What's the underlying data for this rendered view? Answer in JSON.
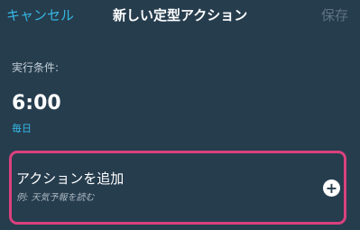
{
  "header": {
    "cancel_label": "キャンセル",
    "title": "新しい定型アクション",
    "save_label": "保存"
  },
  "condition": {
    "label": "実行条件:",
    "time": "6:00",
    "recurrence": "毎日"
  },
  "action": {
    "title": "アクションを追加",
    "hint": "例: 天気予報を読む",
    "icon": "plus-circle-icon"
  },
  "colors": {
    "background": "#263d4e",
    "accent": "#35b7e4",
    "highlight_border": "#d9417d",
    "disabled": "#5f7384"
  }
}
